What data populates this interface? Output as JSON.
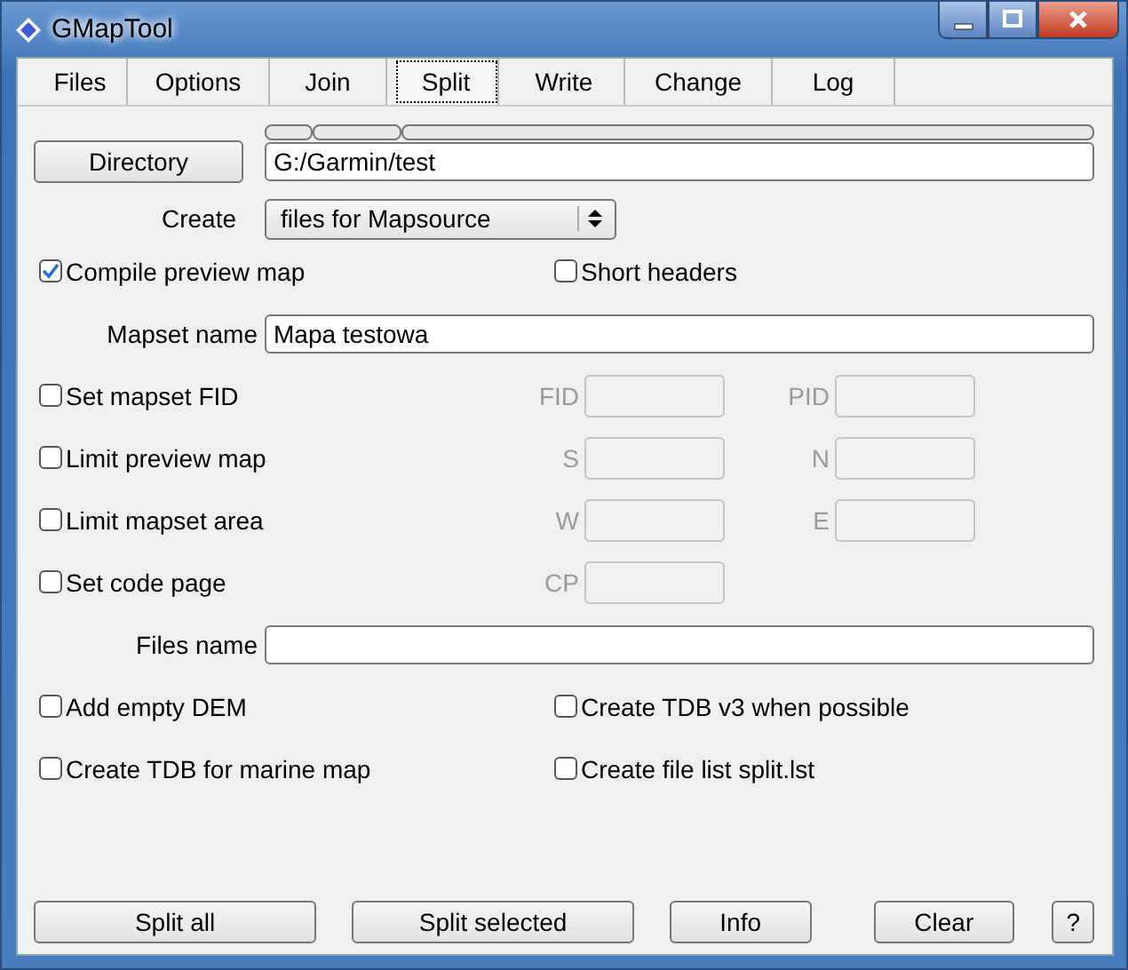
{
  "window": {
    "title": "GMapTool"
  },
  "tabs": [
    {
      "label": "Files",
      "selected": false
    },
    {
      "label": "Options",
      "selected": false
    },
    {
      "label": "Join",
      "selected": false
    },
    {
      "label": "Split",
      "selected": true
    },
    {
      "label": "Write",
      "selected": false
    },
    {
      "label": "Change",
      "selected": false
    },
    {
      "label": "Log",
      "selected": false
    }
  ],
  "directory": {
    "button": "Directory",
    "value": "G:/Garmin/test"
  },
  "create": {
    "label": "Create",
    "value": "files for Mapsource"
  },
  "rows": [
    {
      "kind": "checks",
      "items": [
        {
          "label": "Compile preview map",
          "checked": true
        },
        {
          "label": "Short headers",
          "checked": false
        }
      ]
    },
    {
      "kind": "text",
      "label": "Mapset name",
      "value": "Mapa testowa"
    },
    {
      "kind": "check_fields",
      "check": {
        "label": "Set mapset FID",
        "checked": false
      },
      "fields": [
        {
          "label": "FID",
          "disabled": true
        },
        {
          "label": "PID",
          "disabled": true
        }
      ]
    },
    {
      "kind": "check_fields",
      "check": {
        "label": "Limit preview map",
        "checked": false
      },
      "fields": [
        {
          "label": "S",
          "disabled": true
        },
        {
          "label": "N",
          "disabled": true
        }
      ]
    },
    {
      "kind": "check_fields",
      "check": {
        "label": "Limit mapset area",
        "checked": false
      },
      "fields": [
        {
          "label": "W",
          "disabled": true
        },
        {
          "label": "E",
          "disabled": true
        }
      ]
    },
    {
      "kind": "check_fields",
      "check": {
        "label": "Set code page",
        "checked": false
      },
      "fields": [
        {
          "label": "CP",
          "disabled": true
        }
      ]
    },
    {
      "kind": "text",
      "label": "Files name"
    },
    {
      "kind": "checks",
      "items": [
        {
          "label": "Add empty DEM",
          "checked": false
        },
        {
          "label": "Create TDB v3 when possible",
          "checked": false
        }
      ]
    },
    {
      "kind": "checks",
      "items": [
        {
          "label": "Create TDB for marine map",
          "checked": false
        },
        {
          "label": "Create file list split.lst",
          "checked": false
        }
      ]
    }
  ],
  "buttons": [
    "Split all",
    "Split selected",
    "Info",
    "Clear",
    "?"
  ]
}
